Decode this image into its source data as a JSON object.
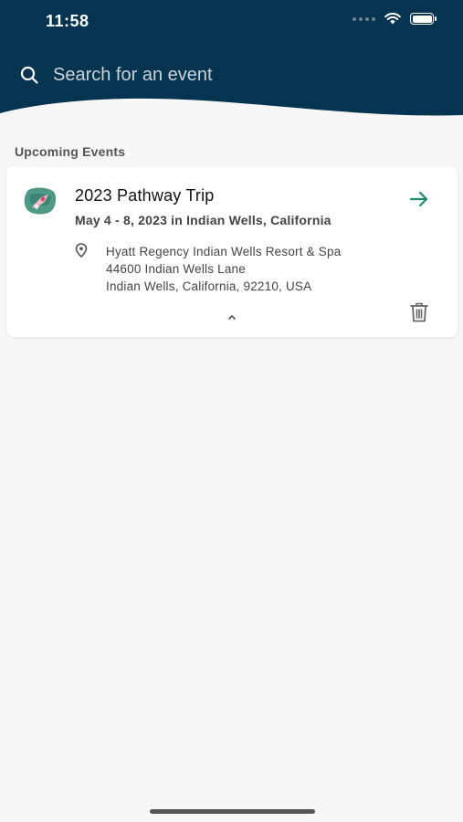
{
  "status_bar": {
    "time": "11:58"
  },
  "search": {
    "placeholder": "Search for an event"
  },
  "section": {
    "title": "Upcoming Events"
  },
  "events": [
    {
      "title": "2023 Pathway Trip",
      "date": "May 4 - 8, 2023 in Indian Wells, California",
      "address_lines": [
        "Hyatt Regency Indian Wells Resort & Spa",
        "44600 Indian Wells Lane",
        "Indian Wells, California, 92210, USA"
      ]
    }
  ],
  "icons": {
    "search": "search-icon",
    "arrow": "arrow-right-icon",
    "pin": "location-pin-icon",
    "chevron": "chevron-up-icon",
    "trash": "trash-icon"
  },
  "colors": {
    "header": "#04344f",
    "accent": "#1f8a6a",
    "background": "#f7f7f7"
  }
}
